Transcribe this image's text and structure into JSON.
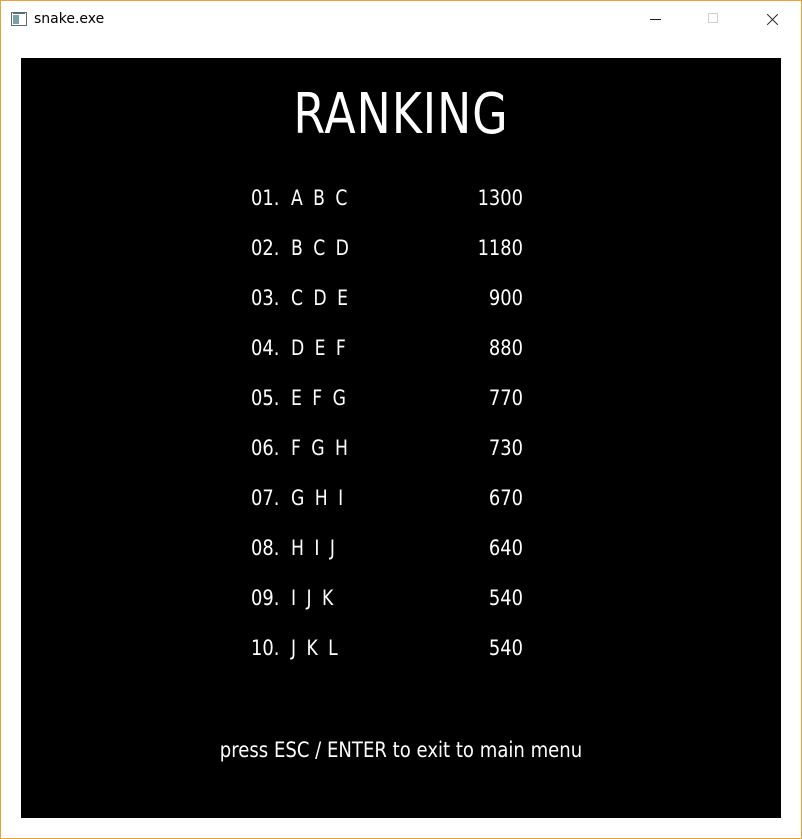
{
  "window": {
    "title": "snake.exe",
    "icon": "app-window-icon",
    "controls": [
      "minimize-icon",
      "maximize-icon",
      "close-icon"
    ]
  },
  "screen": {
    "heading": "RANKING",
    "rows": [
      {
        "pos": "01.",
        "name": "A B C",
        "score": "1300"
      },
      {
        "pos": "02.",
        "name": "B C D",
        "score": "1180"
      },
      {
        "pos": "03.",
        "name": "C D E",
        "score": "900"
      },
      {
        "pos": "04.",
        "name": "D E F",
        "score": "880"
      },
      {
        "pos": "05.",
        "name": "E F G",
        "score": "770"
      },
      {
        "pos": "06.",
        "name": "F G H",
        "score": "730"
      },
      {
        "pos": "07.",
        "name": "G H I",
        "score": "670"
      },
      {
        "pos": "08.",
        "name": "H I J",
        "score": "640"
      },
      {
        "pos": "09.",
        "name": "I J K",
        "score": "540"
      },
      {
        "pos": "10.",
        "name": "J K L",
        "score": "540"
      }
    ],
    "hint": "press ESC / ENTER to exit to main menu"
  },
  "colors": {
    "background": "#000000",
    "text": "#ffffff",
    "window_border": "#e8a33d"
  }
}
